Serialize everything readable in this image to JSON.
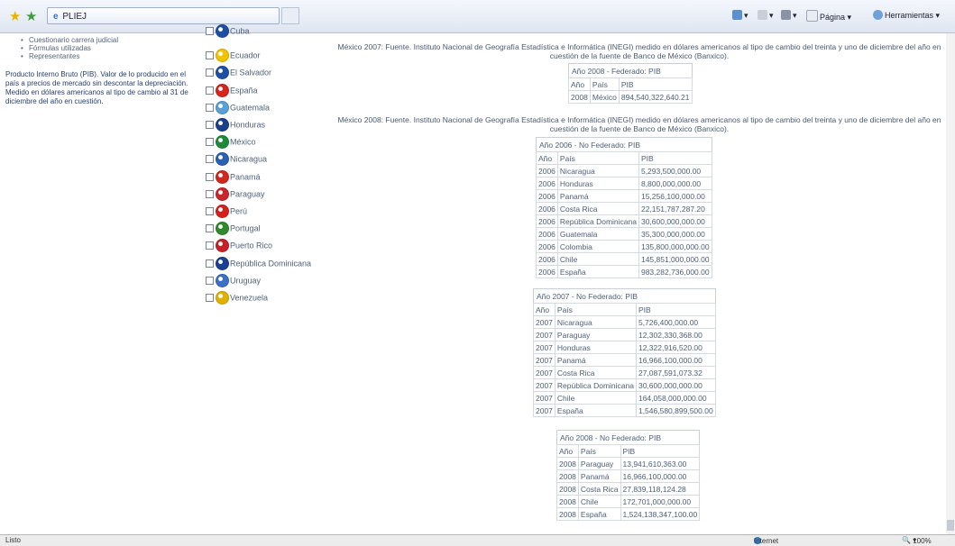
{
  "browser": {
    "tab_title": "PLIEJ",
    "home_label": "",
    "pagina_label": "Página",
    "herramientas_label": "Herramientas",
    "status_text": "Listo",
    "zone_label": "Internet",
    "zoom": "100%"
  },
  "nav": {
    "links": [
      "Cuestionario carrera judicial",
      "Fórmulas utilizadas",
      "Representantes"
    ],
    "pib_definition": "Producto Interno Bruto (PIB). Valor de lo producido en el país a precios de mercado sin descontar la depreciación. Medido en dólares americanos al tipo de cambio al 31 de diciembre del año en cuestión."
  },
  "countries": [
    {
      "name": "Cuba",
      "color": "#1f4fa3"
    },
    {
      "name": "Ecuador",
      "color": "#f2c400"
    },
    {
      "name": "El Salvador",
      "color": "#1d4fa5"
    },
    {
      "name": "España",
      "color": "#d9241c"
    },
    {
      "name": "Guatemala",
      "color": "#5aa0d6"
    },
    {
      "name": "Honduras",
      "color": "#1a3f8c"
    },
    {
      "name": "México",
      "color": "#1d8a3a"
    },
    {
      "name": "Nicaragua",
      "color": "#2b5fb3"
    },
    {
      "name": "Panamá",
      "color": "#d0281f"
    },
    {
      "name": "Paraguay",
      "color": "#c8262b"
    },
    {
      "name": "Perú",
      "color": "#d7201d"
    },
    {
      "name": "Portugal",
      "color": "#2f8a2a"
    },
    {
      "name": "Puerto Rico",
      "color": "#c62128"
    },
    {
      "name": "República Dominicana",
      "color": "#1b3f95"
    },
    {
      "name": "Uruguay",
      "color": "#3d6fc4"
    },
    {
      "name": "Venezuela",
      "color": "#e2b100"
    }
  ],
  "notes": {
    "mexico_2007": "México 2007: Fuente. Instituto Nacional de Geografía Estadística e Informática (INEGI) medido en dólares americanos al tipo de cambio del treinta y uno de diciembre del año en cuestión de la fuente de Banco de México (Banxico).",
    "mexico_2008": "México 2008: Fuente. Instituto Nacional de Geografía Estadística e Informática (INEGI) medido en dólares americanos al tipo de cambio del treinta y uno de diciembre del año en cuestión de la fuente de Banco de México (Banxico)."
  },
  "tables": {
    "fed2008": {
      "caption": "Año 2008 - Federado: PIB",
      "headers": [
        "Año",
        "País",
        "PIB"
      ],
      "rows": [
        [
          "2008",
          "México",
          "894,540,322,640.21"
        ]
      ]
    },
    "nf2006": {
      "caption": "Año 2006 - No Federado: PIB",
      "headers": [
        "Año",
        "País",
        "PIB"
      ],
      "rows": [
        [
          "2006",
          "Nicaragua",
          "5,293,500,000.00"
        ],
        [
          "2006",
          "Honduras",
          "8,800,000,000.00"
        ],
        [
          "2006",
          "Panamá",
          "15,256,100,000.00"
        ],
        [
          "2006",
          "Costa Rica",
          "22,151,787,287.20"
        ],
        [
          "2006",
          "República Dominicana",
          "30,600,000,000.00"
        ],
        [
          "2006",
          "Guatemala",
          "35,300,000,000.00"
        ],
        [
          "2006",
          "Colombia",
          "135,800,000,000.00"
        ],
        [
          "2006",
          "Chile",
          "145,851,000,000.00"
        ],
        [
          "2006",
          "España",
          "983,282,736,000.00"
        ]
      ]
    },
    "nf2007": {
      "caption": "Año 2007 - No Federado: PIB",
      "headers": [
        "Año",
        "País",
        "PIB"
      ],
      "rows": [
        [
          "2007",
          "Nicaragua",
          "5,726,400,000.00"
        ],
        [
          "2007",
          "Paraguay",
          "12,302,330,368.00"
        ],
        [
          "2007",
          "Honduras",
          "12,322,916,520.00"
        ],
        [
          "2007",
          "Panamá",
          "16,966,100,000.00"
        ],
        [
          "2007",
          "Costa Rica",
          "27,087,591,073.32"
        ],
        [
          "2007",
          "República Dominicana",
          "30,600,000,000.00"
        ],
        [
          "2007",
          "Chile",
          "164,058,000,000.00"
        ],
        [
          "2007",
          "España",
          "1,546,580,899,500.00"
        ]
      ]
    },
    "nf2008": {
      "caption": "Año 2008 - No Federado: PIB",
      "headers": [
        "Año",
        "País",
        "PIB"
      ],
      "rows": [
        [
          "2008",
          "Paraguay",
          "13,941,610,363.00"
        ],
        [
          "2008",
          "Panamá",
          "16,966,100,000.00"
        ],
        [
          "2008",
          "Costa Rica",
          "27,839,118,124.28"
        ],
        [
          "2008",
          "Chile",
          "172,701,000,000.00"
        ],
        [
          "2008",
          "España",
          "1,524,138,347,100.00"
        ]
      ]
    }
  }
}
